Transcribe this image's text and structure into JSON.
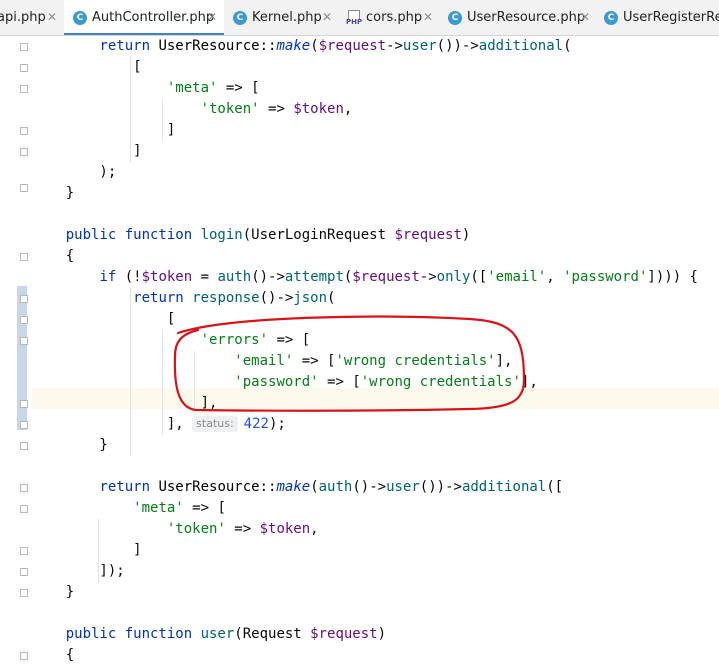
{
  "tabs": [
    {
      "label": "api.php",
      "icon": "php-file-icon"
    },
    {
      "label": "AuthController.php",
      "icon": "php-class-icon",
      "active": true
    },
    {
      "label": "Kernel.php",
      "icon": "php-class-icon"
    },
    {
      "label": "cors.php",
      "icon": "php-file-icon"
    },
    {
      "label": "UserResource.php",
      "icon": "php-class-icon"
    },
    {
      "label": "UserRegisterReq",
      "icon": "php-class-icon"
    }
  ],
  "tab_icons": {
    "class_letter": "C",
    "php_label": "PHP"
  },
  "code": {
    "l1": [
      {
        "t": "        "
      },
      {
        "c": "kw",
        "t": "return "
      },
      {
        "c": "cls",
        "t": "UserResource::"
      },
      {
        "c": "st",
        "t": "make"
      },
      {
        "t": "("
      },
      {
        "c": "var",
        "t": "$request"
      },
      {
        "t": "->"
      },
      {
        "c": "fn",
        "t": "user"
      },
      {
        "t": "())->"
      },
      {
        "c": "fn",
        "t": "additional"
      },
      {
        "t": "("
      }
    ],
    "l2": [
      {
        "t": "            ["
      }
    ],
    "l3": [
      {
        "t": "                "
      },
      {
        "c": "str",
        "t": "'meta'"
      },
      {
        "t": " => ["
      }
    ],
    "l4": [
      {
        "t": "                    "
      },
      {
        "c": "str",
        "t": "'token'"
      },
      {
        "t": " => "
      },
      {
        "c": "var",
        "t": "$token"
      },
      {
        "t": ","
      }
    ],
    "l5": [
      {
        "t": "                ]"
      }
    ],
    "l6": [
      {
        "t": "            ]"
      }
    ],
    "l7": [
      {
        "t": "        );"
      }
    ],
    "l8": [
      {
        "t": "    }"
      }
    ],
    "l9": [
      {
        "t": ""
      }
    ],
    "l10": [
      {
        "t": "    "
      },
      {
        "c": "kw",
        "t": "public function "
      },
      {
        "c": "fn",
        "t": "login"
      },
      {
        "t": "(UserLoginRequest "
      },
      {
        "c": "var",
        "t": "$request"
      },
      {
        "t": ")"
      }
    ],
    "l11": [
      {
        "t": "    {"
      }
    ],
    "l12": [
      {
        "t": "        "
      },
      {
        "c": "kw",
        "t": "if "
      },
      {
        "t": "(!"
      },
      {
        "c": "var",
        "t": "$token"
      },
      {
        "t": " = "
      },
      {
        "c": "fn",
        "t": "auth"
      },
      {
        "t": "()->"
      },
      {
        "c": "fn",
        "t": "attempt"
      },
      {
        "t": "("
      },
      {
        "c": "var",
        "t": "$request"
      },
      {
        "t": "->"
      },
      {
        "c": "fn",
        "t": "only"
      },
      {
        "t": "(["
      },
      {
        "c": "str",
        "t": "'email'"
      },
      {
        "t": ", "
      },
      {
        "c": "str",
        "t": "'password'"
      },
      {
        "t": "]))) {"
      }
    ],
    "l13": [
      {
        "t": "            "
      },
      {
        "c": "kw",
        "t": "return "
      },
      {
        "c": "fn",
        "t": "response"
      },
      {
        "t": "()->"
      },
      {
        "c": "fn",
        "t": "json"
      },
      {
        "t": "("
      }
    ],
    "l14": [
      {
        "t": "                ["
      }
    ],
    "l15": [
      {
        "t": "                    "
      },
      {
        "c": "str",
        "t": "'errors'"
      },
      {
        "t": " => ["
      }
    ],
    "l16": [
      {
        "t": "                        "
      },
      {
        "c": "str",
        "t": "'email'"
      },
      {
        "t": " => ["
      },
      {
        "c": "str",
        "t": "'wrong credentials'"
      },
      {
        "t": "],"
      }
    ],
    "l17": [
      {
        "t": "                        "
      },
      {
        "c": "str",
        "t": "'password'"
      },
      {
        "t": " => ["
      },
      {
        "c": "str",
        "t": "'wrong credentials'"
      },
      {
        "t": "],"
      }
    ],
    "l18": [
      {
        "t": "                    ],"
      }
    ],
    "l19": [
      {
        "t": "                ], "
      },
      {
        "c": "hint",
        "t": "status:"
      },
      {
        "c": "num",
        "t": "422"
      },
      {
        "t": ");"
      }
    ],
    "l20": [
      {
        "t": "        }"
      }
    ],
    "l21": [
      {
        "t": ""
      }
    ],
    "l22": [
      {
        "t": "        "
      },
      {
        "c": "kw",
        "t": "return "
      },
      {
        "c": "cls",
        "t": "UserResource::"
      },
      {
        "c": "st",
        "t": "make"
      },
      {
        "t": "("
      },
      {
        "c": "fn",
        "t": "auth"
      },
      {
        "t": "()->"
      },
      {
        "c": "fn",
        "t": "user"
      },
      {
        "t": "())->"
      },
      {
        "c": "fn",
        "t": "additional"
      },
      {
        "t": "(["
      }
    ],
    "l23": [
      {
        "t": "            "
      },
      {
        "c": "str",
        "t": "'meta'"
      },
      {
        "t": " => ["
      }
    ],
    "l24": [
      {
        "t": "                "
      },
      {
        "c": "str",
        "t": "'token'"
      },
      {
        "t": " => "
      },
      {
        "c": "var",
        "t": "$token"
      },
      {
        "t": ","
      }
    ],
    "l25": [
      {
        "t": "            ]"
      }
    ],
    "l26": [
      {
        "t": "        ]);"
      }
    ],
    "l27": [
      {
        "t": "    }"
      }
    ],
    "l28": [
      {
        "t": ""
      }
    ],
    "l29": [
      {
        "t": "    "
      },
      {
        "c": "kw",
        "t": "public function "
      },
      {
        "c": "fn",
        "t": "user"
      },
      {
        "t": "(Request "
      },
      {
        "c": "var",
        "t": "$request"
      },
      {
        "t": ")"
      }
    ],
    "l30": [
      {
        "t": "    {"
      }
    ]
  },
  "colors": {
    "keyword": "#0033b3",
    "function": "#00627a",
    "variable": "#660e7a",
    "string": "#067d17",
    "number": "#1750eb",
    "annotation": "#d7131a"
  }
}
